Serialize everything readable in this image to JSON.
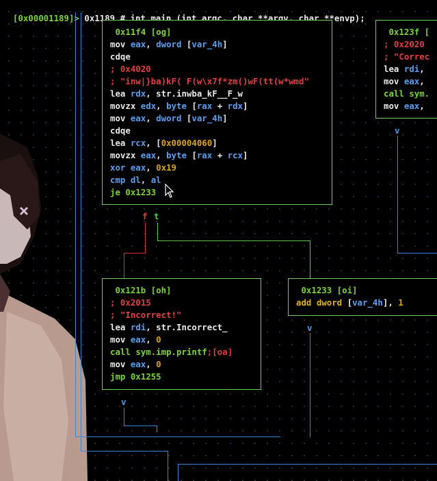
{
  "colors": {
    "border": "#6fcf58",
    "keyword": "#7bd23c",
    "reg": "#5b9ff0",
    "comment": "#e04040",
    "number": "#d8a31e",
    "wire_blue": "#3a86d8",
    "wire_red": "#d03030",
    "wire_green": "#5ec84a"
  },
  "top_bar": {
    "address": "[0x00001189]>",
    "func": " 0x1189 # int main (int argc, char **argv, char **envp);"
  },
  "nodes": {
    "og": {
      "header": " 0x11f4 [og]",
      "l1": [
        "mov ",
        "eax",
        ", ",
        "dword",
        " [",
        "var_4h",
        "]"
      ],
      "l2": "cdqe",
      "l3": "; 0x4020",
      "l4": "; \"inw|}ba)kF( F(w\\x7f*zm()wF(tt(w*wmd\"",
      "l5": [
        "lea ",
        "rdx",
        ", str.inwba_kF__F_w"
      ],
      "l6": [
        "movzx ",
        "edx",
        ", ",
        "byte",
        " [",
        "rax",
        " + ",
        "rdx",
        "]"
      ],
      "l7": [
        "mov ",
        "eax",
        ", ",
        "dword",
        " [",
        "var_4h",
        "]"
      ],
      "l8": "cdqe",
      "l9": [
        "lea ",
        "rcx",
        ", [",
        "0x00004060",
        "]"
      ],
      "l10": [
        "movzx ",
        "eax",
        ", ",
        "byte",
        " [",
        "rax",
        " + ",
        "rcx",
        "]"
      ],
      "l11": [
        "xor ",
        "eax",
        ", ",
        "0x19"
      ],
      "l12": [
        "cmp ",
        "dl",
        ", ",
        "al"
      ],
      "l13": "je 0x1233"
    },
    "oh": {
      "header": " 0x121b [oh]",
      "l1": "; 0x2015",
      "l2": "; \"Incorrect!\"",
      "l3": [
        "lea ",
        "rdi",
        ", str.Incorrect_"
      ],
      "l4": [
        "mov ",
        "eax",
        ", ",
        "0"
      ],
      "l5": [
        "call ",
        "sym.imp.printf",
        ";[oa]"
      ],
      "l6": [
        "mov ",
        "eax",
        ", ",
        "0"
      ],
      "l7": "jmp 0x1255"
    },
    "oi": {
      "header": " 0x1233 [oi]",
      "l1": [
        "add ",
        "dword",
        " [",
        "var_4h",
        "]",
        ", ",
        "1"
      ]
    },
    "side": {
      "header": " 0x123f [",
      "l1": "; 0x2020",
      "l2": "; \"Correc",
      "l3": [
        "lea ",
        "rdi",
        ","
      ],
      "l4": [
        "mov ",
        "eax",
        ","
      ],
      "l5": "call sym.",
      "l6": [
        "mov ",
        "eax",
        ","
      ]
    }
  },
  "edge_labels": {
    "f": "f",
    "t": "t",
    "v": "v"
  }
}
